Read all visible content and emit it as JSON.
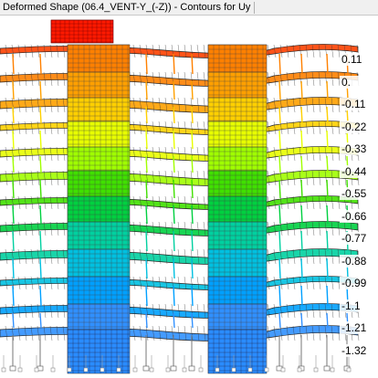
{
  "window": {
    "title": "Deformed Shape (06.4_VENT-Y_(-Z)) - Contours for Uy"
  },
  "legend": {
    "labels": [
      "0.11",
      "0.",
      "-0.11",
      "-0.22",
      "-0.33",
      "-0.44",
      "-0.55",
      "-0.66",
      "-0.77",
      "-0.88",
      "-0.99",
      "-1.1",
      "-1.21",
      "-1.32"
    ],
    "colors": [
      "#ff0000",
      "#ff4000",
      "#ff8000",
      "#ffa000",
      "#ffd000",
      "#e8ff00",
      "#a0ff00",
      "#40e000",
      "#00d040",
      "#00d0a0",
      "#00c0e0",
      "#00a0ff",
      "#3090ff",
      "#4080ff"
    ]
  }
}
